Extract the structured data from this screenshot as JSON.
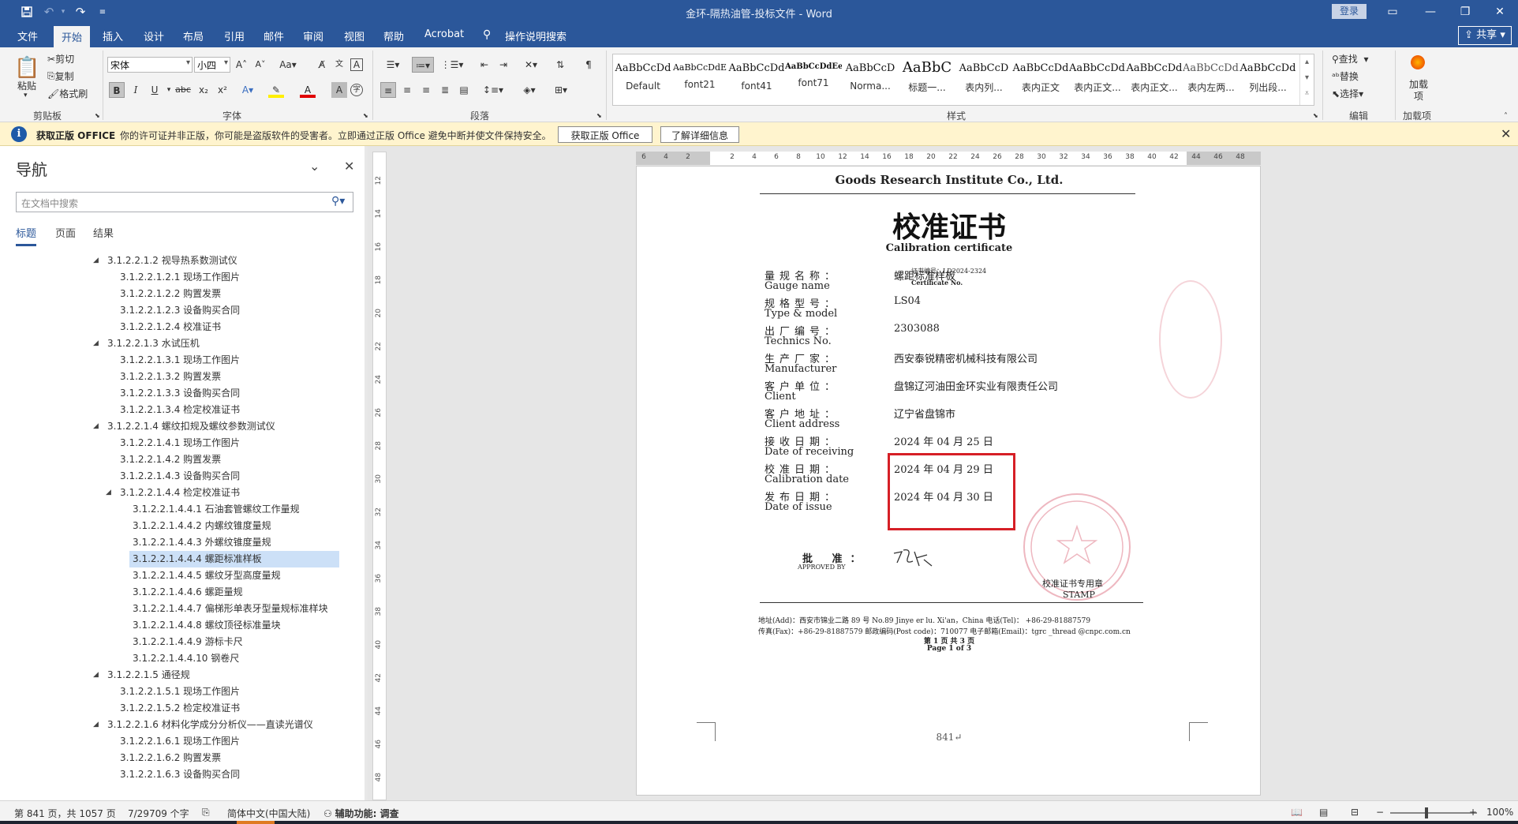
{
  "titlebar": {
    "title": "金环-隔热油管-投标文件  -  Word",
    "login": "登录"
  },
  "menu": {
    "items": [
      "文件",
      "开始",
      "插入",
      "设计",
      "布局",
      "引用",
      "邮件",
      "审阅",
      "视图",
      "帮助",
      "Acrobat",
      "操作说明搜索"
    ],
    "share": "共享"
  },
  "ribbon": {
    "clipboard": {
      "paste": "粘贴",
      "cut": "剪切",
      "copy": "复制",
      "format_painter": "格式刷",
      "label": "剪贴板"
    },
    "font": {
      "name": "宋体",
      "size": "小四",
      "label": "字体"
    },
    "paragraph": {
      "label": "段落"
    },
    "styles": {
      "label": "样式",
      "items": [
        {
          "preview": "AaBbCcDd",
          "name": "Default"
        },
        {
          "preview": "AaBbCcDdE",
          "name": "font21"
        },
        {
          "preview": "AaBbCcDd",
          "name": "font41"
        },
        {
          "preview": "AaBbCcDdEe",
          "name": "font71"
        },
        {
          "preview": "AaBbCcD",
          "name": "Norma..."
        },
        {
          "preview": "AaBbC",
          "name": "标题一..."
        },
        {
          "preview": "AaBbCcD",
          "name": "表内列..."
        },
        {
          "preview": "AaBbCcDd",
          "name": "表内正文"
        },
        {
          "preview": "AaBbCcDdI",
          "name": "表内正文..."
        },
        {
          "preview": "AaBbCcDd",
          "name": "表内正文..."
        },
        {
          "preview": "AaBbCcDdI",
          "name": "表内左两..."
        },
        {
          "preview": "AaBbCcDd",
          "name": "列出段..."
        }
      ]
    },
    "editing": {
      "find": "查找",
      "replace": "替换",
      "select": "选择",
      "label": "编辑"
    },
    "addins": {
      "load": "加载项",
      "label": "加载项"
    }
  },
  "infobar": {
    "title": "获取正版 OFFICE",
    "message": "你的许可证并非正版，你可能是盗版软件的受害者。立即通过正版 Office 避免中断并使文件保持安全。",
    "button1": "获取正版 Office",
    "button2": "了解详细信息"
  },
  "nav": {
    "title": "导航",
    "search_placeholder": "在文档中搜索",
    "tabs": [
      "标题",
      "页面",
      "结果"
    ],
    "items": [
      {
        "text": "3.1.2.2.1.2 视导热系数测试仪",
        "level": 0,
        "arrow": true
      },
      {
        "text": "3.1.2.2.1.2.1 现场工作图片",
        "level": 1
      },
      {
        "text": "3.1.2.2.1.2.2 购置发票",
        "level": 1
      },
      {
        "text": "3.1.2.2.1.2.3 设备购买合同",
        "level": 1
      },
      {
        "text": "3.1.2.2.1.2.4 校准证书",
        "level": 1
      },
      {
        "text": "3.1.2.2.1.3 水试压机",
        "level": 0,
        "arrow": true
      },
      {
        "text": "3.1.2.2.1.3.1 现场工作图片",
        "level": 1
      },
      {
        "text": "3.1.2.2.1.3.2 购置发票",
        "level": 1
      },
      {
        "text": "3.1.2.2.1.3.3 设备购买合同",
        "level": 1
      },
      {
        "text": "3.1.2.2.1.3.4 检定校准证书",
        "level": 1
      },
      {
        "text": "3.1.2.2.1.4 螺纹扣规及螺纹参数测试仪",
        "level": 0,
        "arrow": true
      },
      {
        "text": "3.1.2.2.1.4.1 现场工作图片",
        "level": 1
      },
      {
        "text": "3.1.2.2.1.4.2 购置发票",
        "level": 1
      },
      {
        "text": "3.1.2.2.1.4.3 设备购买合同",
        "level": 1
      },
      {
        "text": "3.1.2.2.1.4.4 检定校准证书",
        "level": 1,
        "arrow": true
      },
      {
        "text": "3.1.2.2.1.4.4.1 石油套管螺纹工作量规",
        "level": 2
      },
      {
        "text": "3.1.2.2.1.4.4.2 内螺纹锥度量规",
        "level": 2
      },
      {
        "text": "3.1.2.2.1.4.4.3 外螺纹锥度量规",
        "level": 2
      },
      {
        "text": "3.1.2.2.1.4.4.4 螺距标准样板",
        "level": 2,
        "selected": true
      },
      {
        "text": "3.1.2.2.1.4.4.5 螺纹牙型高度量规",
        "level": 2
      },
      {
        "text": "3.1.2.2.1.4.4.6 螺距量规",
        "level": 2
      },
      {
        "text": "3.1.2.2.1.4.4.7 偏梯形单表牙型量规标准样块",
        "level": 2
      },
      {
        "text": "3.1.2.2.1.4.4.8 螺纹顶径标准量块",
        "level": 2
      },
      {
        "text": "3.1.2.2.1.4.4.9 游标卡尺",
        "level": 2
      },
      {
        "text": "3.1.2.2.1.4.4.10 钢卷尺",
        "level": 2
      },
      {
        "text": "3.1.2.2.1.5 通径规",
        "level": 0,
        "arrow": true
      },
      {
        "text": "3.1.2.2.1.5.1 现场工作图片",
        "level": 1
      },
      {
        "text": "3.1.2.2.1.5.2 检定校准证书",
        "level": 1
      },
      {
        "text": "3.1.2.2.1.6 材料化学成分分析仪——直读光谱仪",
        "level": 0,
        "arrow": true
      },
      {
        "text": "3.1.2.2.1.6.1 现场工作图片",
        "level": 1
      },
      {
        "text": "3.1.2.2.1.6.2 购置发票",
        "level": 1
      },
      {
        "text": "3.1.2.2.1.6.3 设备购买合同",
        "level": 1
      }
    ]
  },
  "ruler": {
    "h_ticks": [
      "6",
      "4",
      "2",
      "",
      "2",
      "4",
      "6",
      "8",
      "10",
      "12",
      "14",
      "16",
      "18",
      "20",
      "22",
      "24",
      "26",
      "28",
      "30",
      "32",
      "34",
      "36",
      "38",
      "40",
      "42",
      "44",
      "46",
      "48"
    ],
    "v_ticks": [
      "12",
      "14",
      "16",
      "18",
      "20",
      "22",
      "24",
      "26",
      "28",
      "30",
      "32",
      "34",
      "36",
      "38",
      "40",
      "42",
      "44",
      "46",
      "48"
    ]
  },
  "document": {
    "company": "Goods Research Institute Co., Ltd.",
    "title": "校准证书",
    "subtitle": "Calibration certificate",
    "cert_no_cn": "证书编号：LD2024-2324",
    "cert_no_en": "Certificate No.",
    "fields": [
      {
        "cn": "量规名称：",
        "en": "Gauge name",
        "value": "螺距标准样板"
      },
      {
        "cn": "规格型号：",
        "en": "Type & model",
        "value": "LS04"
      },
      {
        "cn": "出厂编号：",
        "en": "Technics No.",
        "value": "2303088"
      },
      {
        "cn": "生产厂家：",
        "en": "Manufacturer",
        "value": "西安泰锐精密机械科技有限公司"
      },
      {
        "cn": "客户单位：",
        "en": "Client",
        "value": "盘锦辽河油田金环实业有限责任公司"
      },
      {
        "cn": "客户地址：",
        "en": "Client address",
        "value": "辽宁省盘锦市"
      },
      {
        "cn": "接收日期：",
        "en": "Date of receiving",
        "value": "2024 年 04 月 25 日"
      },
      {
        "cn": "校准日期：",
        "en": "Calibration date",
        "value": "2024 年 04 月 29 日"
      },
      {
        "cn": "发布日期：",
        "en": "Date of issue",
        "value": "2024 年 04 月 30 日"
      }
    ],
    "approved_cn": "批 准：",
    "approved_en": "APPROVED BY",
    "stamp_cn": "校准证书专用章",
    "stamp_en": "STAMP",
    "footer1": "地址(Add)：西安市锦业二路 89 号      No.89 Jinye er lu. Xi'an，China          电话(Tel)：  +86-29-81887579",
    "footer2": "传真(Fax)：+86-29-81887579    邮政编码(Post code)：710077    电子邮箱(Email)：tgrc _thread @cnpc.com.cn",
    "page_cn": "第 1 页 共 3 页",
    "page_en": "Page 1 of 3",
    "page_number": "841↵"
  },
  "status": {
    "page": "第 841 页，共 1057 页",
    "words": "7/29709 个字",
    "language": "简体中文(中国大陆)",
    "accessibility": "辅助功能: 调查",
    "zoom": "100%"
  }
}
